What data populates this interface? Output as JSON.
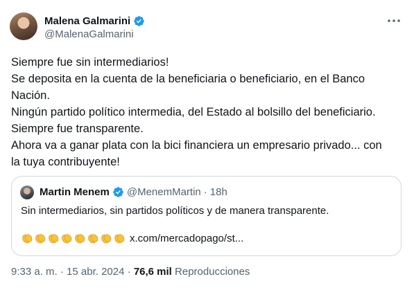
{
  "author": {
    "name": "Malena Galmarini",
    "handle": "@MalenaGalmarini"
  },
  "tweet_lines": [
    "Siempre fue sin intermediarios!",
    "Se deposita en la cuenta de la beneficiaria o beneficiario, en el Banco",
    "Nación.",
    "Ningún partido político intermedia, del Estado al bolsillo del beneficiario.",
    "Siempre fue transparente.",
    "Ahora va a ganar plata con la bici financiera un empresario privado... con",
    "la tuya contribuyente!"
  ],
  "quote": {
    "name": "Martin Menem",
    "handle": "@MenemMartin",
    "separator": "·",
    "time": "18h",
    "text": "Sin intermediarios, sin partidos políticos y de manera transparente.",
    "emoji": "👏👏👏👏👏👏👏👏",
    "link": "x.com/mercadopago/st..."
  },
  "meta": {
    "time": "9:33 a. m.",
    "separator": "·",
    "date": "15 abr. 2024",
    "views_count": "76,6 mil",
    "views_label": "Reproducciones"
  },
  "colors": {
    "verified": "#1d9bf0",
    "secondary_text": "#536471",
    "border": "#cfd9de"
  },
  "icons": [
    "verified-badge-icon",
    "more-options-icon",
    "clapping-hands-emoji"
  ]
}
